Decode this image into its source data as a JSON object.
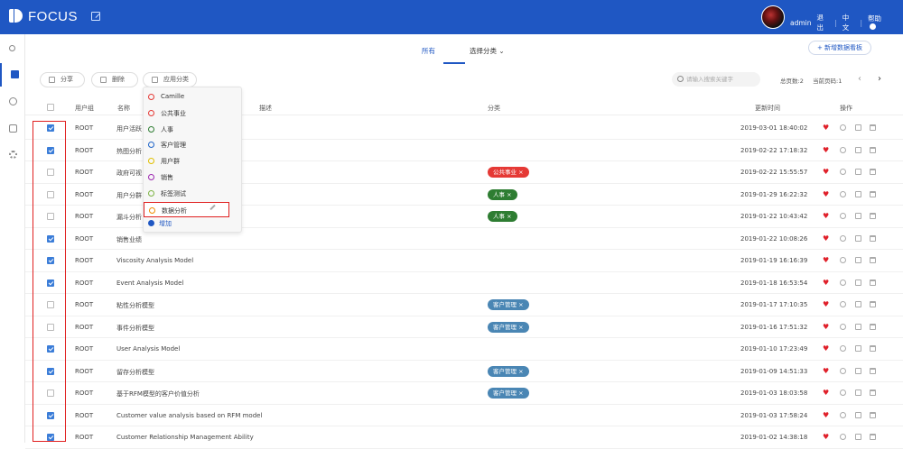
{
  "app": {
    "name": "FOCUS",
    "user": "admin",
    "logout": "退出",
    "lang": "中文",
    "help": "帮助"
  },
  "tabs": {
    "all": "所有",
    "category": "选择分类"
  },
  "new_button": "+ 新增数据看板",
  "toolbar": {
    "share": "分享",
    "delete": "删除",
    "apply_category": "应用分类",
    "search_placeholder": "请输入搜索关键字",
    "total_pages": "总页数:2",
    "current_page": "当前页码:1",
    "prev": "‹",
    "next": "›"
  },
  "headers": {
    "group": "用户组",
    "name": "名称",
    "desc": "描述",
    "category": "分类",
    "updated": "更新时间",
    "ops": "操作"
  },
  "colors": {
    "brand": "#1f57c3",
    "tag_red": "#e53935",
    "tag_green": "#2e7d32",
    "tag_blue": "#4a86b4"
  },
  "dropdown": {
    "items": [
      {
        "label": "Camille",
        "color": "#e53935"
      },
      {
        "label": "公共事业",
        "color": "#e53935"
      },
      {
        "label": "人事",
        "color": "#2e7d32"
      },
      {
        "label": "客户管理",
        "color": "#1e64c8"
      },
      {
        "label": "用户群",
        "color": "#e0c000"
      },
      {
        "label": "销售",
        "color": "#9c27b0"
      },
      {
        "label": "标签测试",
        "color": "#7cb342"
      },
      {
        "label": "数据分析",
        "color": "#ef8c00"
      }
    ],
    "add": "增加"
  },
  "rows": [
    {
      "checked": true,
      "group": "ROOT",
      "name": "用户活跃",
      "tag": "",
      "tag_color": "",
      "time": "2019-03-01 18:40:02"
    },
    {
      "checked": true,
      "group": "ROOT",
      "name": "热图分析",
      "tag": "",
      "tag_color": "",
      "time": "2019-02-22 17:18:32"
    },
    {
      "checked": false,
      "group": "ROOT",
      "name": "政府可视",
      "tag": "公共事业 ×",
      "tag_color": "#e53935",
      "time": "2019-02-22 15:55:57"
    },
    {
      "checked": false,
      "group": "ROOT",
      "name": "用户分群",
      "tag": "人事 ×",
      "tag_color": "#2e7d32",
      "time": "2019-01-29 16:22:32"
    },
    {
      "checked": false,
      "group": "ROOT",
      "name": "漏斗分析",
      "tag": "人事 ×",
      "tag_color": "#2e7d32",
      "time": "2019-01-22 10:43:42"
    },
    {
      "checked": true,
      "group": "ROOT",
      "name": "销售业绩",
      "tag": "",
      "tag_color": "",
      "time": "2019-01-22 10:08:26"
    },
    {
      "checked": true,
      "group": "ROOT",
      "name": "Viscosity Analysis Model",
      "tag": "",
      "tag_color": "",
      "time": "2019-01-19 16:16:39"
    },
    {
      "checked": true,
      "group": "ROOT",
      "name": "Event Analysis Model",
      "tag": "",
      "tag_color": "",
      "time": "2019-01-18 16:53:54"
    },
    {
      "checked": false,
      "group": "ROOT",
      "name": "粘性分析模型",
      "tag": "客户管理 ×",
      "tag_color": "#4a86b4",
      "time": "2019-01-17 17:10:35"
    },
    {
      "checked": false,
      "group": "ROOT",
      "name": "事件分析模型",
      "tag": "客户管理 ×",
      "tag_color": "#4a86b4",
      "time": "2019-01-16 17:51:32"
    },
    {
      "checked": true,
      "group": "ROOT",
      "name": "User Analysis Model",
      "tag": "",
      "tag_color": "",
      "time": "2019-01-10 17:23:49"
    },
    {
      "checked": true,
      "group": "ROOT",
      "name": "留存分析模型",
      "tag": "客户管理 ×",
      "tag_color": "#4a86b4",
      "time": "2019-01-09 14:51:33"
    },
    {
      "checked": false,
      "group": "ROOT",
      "name": "基于RFM模型的客户价值分析",
      "tag": "客户管理 ×",
      "tag_color": "#4a86b4",
      "time": "2019-01-03 18:03:58"
    },
    {
      "checked": true,
      "group": "ROOT",
      "name": "Customer value analysis based on RFM model",
      "tag": "",
      "tag_color": "",
      "time": "2019-01-03 17:58:24"
    },
    {
      "checked": true,
      "group": "ROOT",
      "name": "Customer Relationship Management Ability",
      "tag": "",
      "tag_color": "",
      "time": "2019-01-02 14:38:18"
    }
  ]
}
